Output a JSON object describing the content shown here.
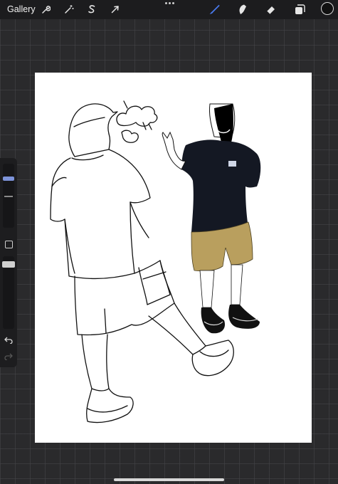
{
  "toolbar": {
    "gallery_label": "Gallery",
    "left_tools": [
      {
        "icon": "wrench-icon",
        "name": "actions-button"
      },
      {
        "icon": "magic-wand-icon",
        "name": "adjustments-button"
      },
      {
        "icon": "selection-s-icon",
        "name": "selection-button"
      },
      {
        "icon": "cursor-arrow-icon",
        "name": "transform-button"
      }
    ],
    "right_tools": [
      {
        "icon": "brush-icon",
        "name": "paint-tool-button",
        "active": true
      },
      {
        "icon": "smudge-icon",
        "name": "smudge-tool-button"
      },
      {
        "icon": "eraser-icon",
        "name": "eraser-tool-button"
      },
      {
        "icon": "layers-icon",
        "name": "layers-button"
      }
    ],
    "active_color": "#111111",
    "accent_color": "#4a7bf0"
  },
  "sidebar": {
    "brush_size_slider": "size-slider",
    "opacity_slider": "opacity-slider",
    "modify_icon": "square-icon",
    "undo_icon": "undo-icon",
    "redo_icon": "redo-icon"
  },
  "canvas": {
    "background": "#ffffff",
    "artwork": "two-figures-sketch"
  }
}
